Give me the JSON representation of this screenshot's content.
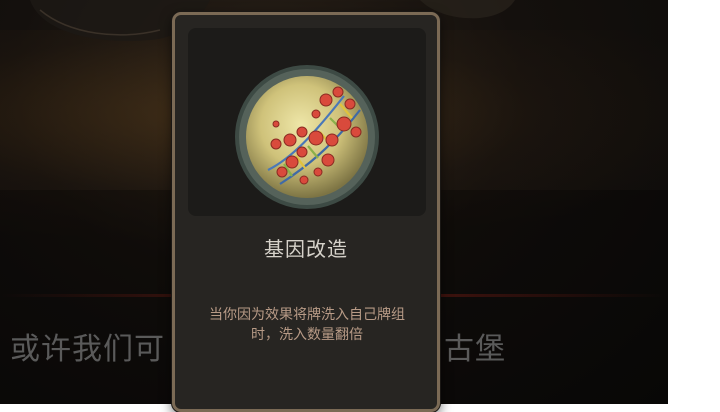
{
  "background": {
    "dialogue_left": "或许我们可",
    "dialogue_right": "古堡"
  },
  "card": {
    "title": "基因改造",
    "description": "当你因为效果将牌洗入自己牌组时，洗入数量翻倍",
    "icon": "dna-petri-dish-icon"
  },
  "colors": {
    "card_border": "#7b6a55",
    "card_bg": "#272522",
    "title_text": "#d6d2ca",
    "desc_text": "#b79a86",
    "dish_fill": "#d8d08a",
    "dna_node": "#d94a3c"
  }
}
